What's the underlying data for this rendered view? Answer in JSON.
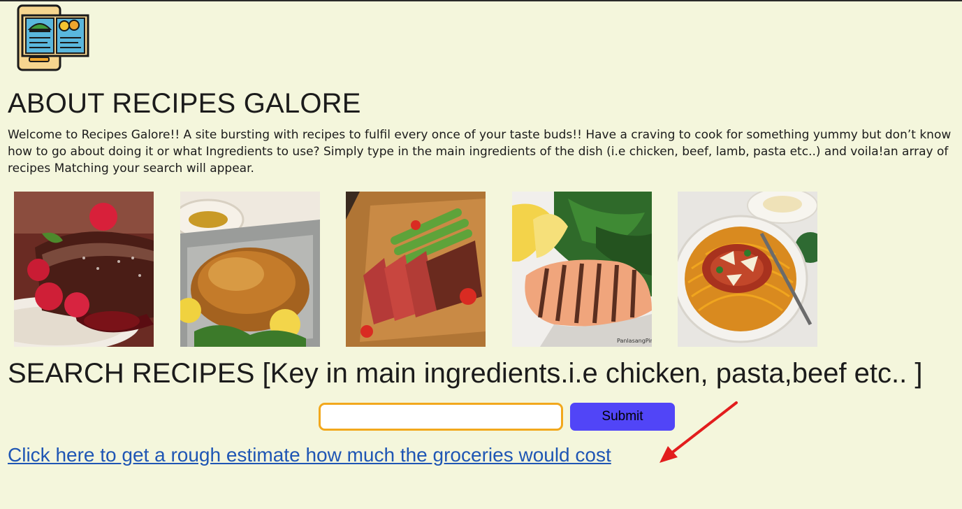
{
  "about": {
    "title": "ABOUT RECIPES GALORE",
    "intro_lines": [
      "Welcome to Recipes Galore!! A site bursting with recipes to fulfil every once of your taste buds!! Have a craving to cook for something yummy but don’t know",
      "how to go about doing it or what Ingredients to use? Simply type in the main ingredients of the dish (i.e chicken, beef, lamb, pasta etc..) and voila!an array of",
      "recipes Matching your search will appear."
    ]
  },
  "gallery": {
    "images": [
      {
        "name": "chocolate-lava-cake-image"
      },
      {
        "name": "roast-chicken-image"
      },
      {
        "name": "sliced-steak-image"
      },
      {
        "name": "grilled-salmon-steak-image"
      },
      {
        "name": "spaghetti-bolognese-image"
      }
    ],
    "watermark": "PanlasangPinoy"
  },
  "search": {
    "title": "SEARCH RECIPES [Key in main ingredients.i.e chicken, pasta,beef etc.. ]",
    "input_value": "",
    "submit_label": "Submit"
  },
  "cost_link": {
    "label": "Click here to get a rough estimate how much the groceries would cost"
  },
  "icons": {
    "logo": "recipe-book-tablet-icon",
    "annotation": "red-arrow-icon"
  },
  "colors": {
    "page_background": "#f4f6dc",
    "input_border": "#f2a81d",
    "submit_button": "#5145f7",
    "link": "#1f56b4",
    "arrow": "#e21d1d"
  }
}
